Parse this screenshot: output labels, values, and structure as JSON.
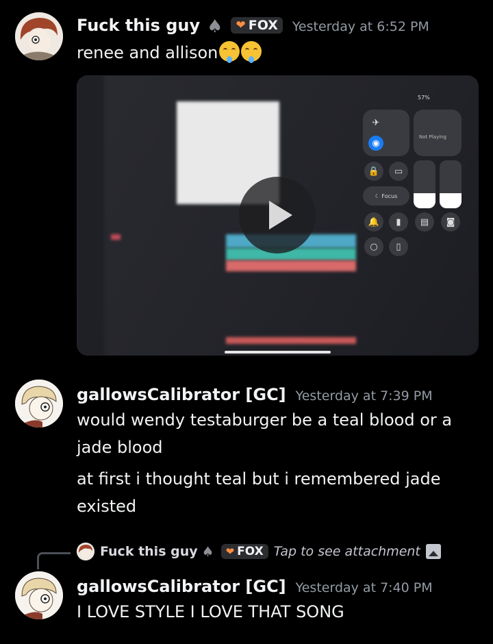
{
  "messages": [
    {
      "username": "Fuck this guy",
      "role_icon": "spade-icon",
      "tag": {
        "icon": "orange-heart-icon",
        "label": "FOX"
      },
      "timestamp": "Yesterday at 6:52 PM",
      "text": "renee and allison",
      "emojis": [
        "drooling-smile-emoji",
        "drooling-smile-emoji"
      ],
      "attachment": {
        "type": "video",
        "preview": {
          "battery": "57%",
          "media_status": "Not Playing",
          "focus_label": "Focus"
        }
      }
    },
    {
      "username": "gallowsCalibrator [GC]",
      "timestamp": "Yesterday at 7:39 PM",
      "lines": [
        "would wendy testaburger be a teal blood or a jade blood",
        "at first i thought teal but i remembered jade existed"
      ]
    },
    {
      "reply_to": {
        "username": "Fuck this guy",
        "role_icon": "spade-icon",
        "tag": {
          "icon": "orange-heart-icon",
          "label": "FOX"
        },
        "preview": "Tap to see attachment",
        "preview_icon": "image-icon"
      },
      "username": "gallowsCalibrator [GC]",
      "timestamp": "Yesterday at 7:40 PM",
      "text": "I LOVE STYLE I LOVE THAT SONG"
    }
  ],
  "colors": {
    "background": "#000000",
    "username": "#f2f3f5",
    "timestamp": "#949ba4",
    "tag_bg": "#2b2d31"
  }
}
